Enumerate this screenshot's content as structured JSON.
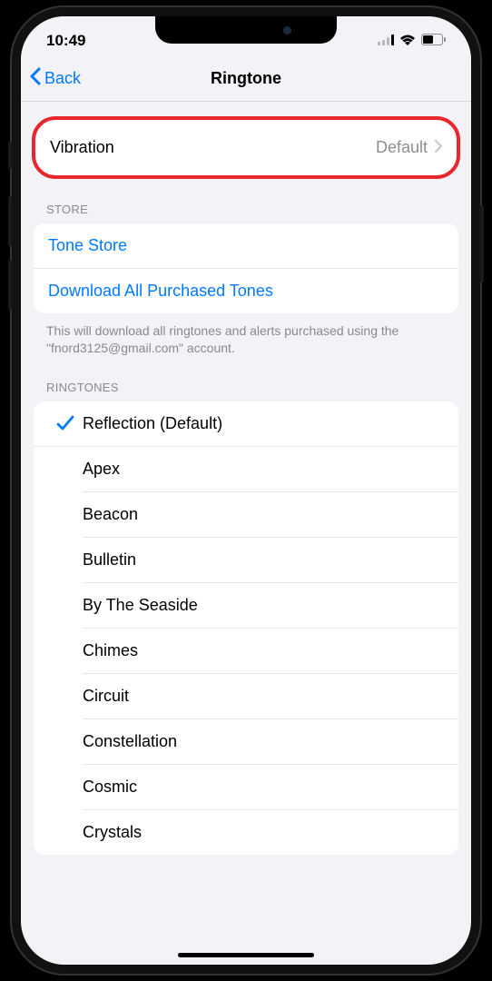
{
  "status": {
    "time": "10:49"
  },
  "nav": {
    "back_label": "Back",
    "title": "Ringtone"
  },
  "vibration": {
    "label": "Vibration",
    "value": "Default"
  },
  "store": {
    "header": "STORE",
    "tone_store": "Tone Store",
    "download_all": "Download All Purchased Tones",
    "footer": "This will download all ringtones and alerts purchased using the \"fnord3125@gmail.com\" account."
  },
  "ringtones": {
    "header": "RINGTONES",
    "selected_index": 0,
    "items": [
      "Reflection (Default)",
      "Apex",
      "Beacon",
      "Bulletin",
      "By The Seaside",
      "Chimes",
      "Circuit",
      "Constellation",
      "Cosmic",
      "Crystals"
    ]
  }
}
